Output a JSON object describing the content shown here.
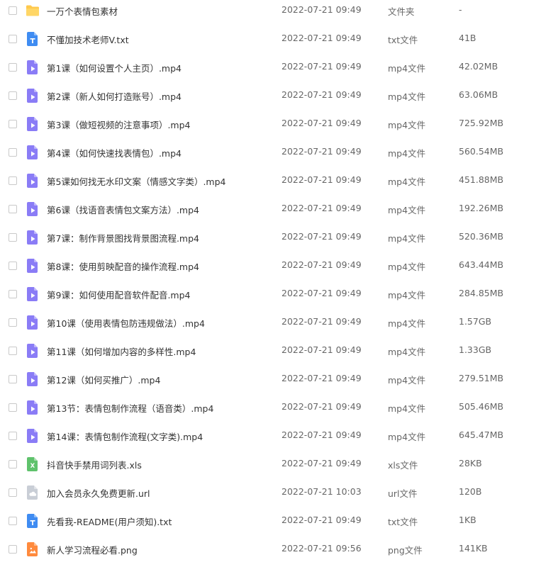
{
  "files": [
    {
      "name": "一万个表情包素材",
      "date": "2022-07-21 09:49",
      "type": "文件夹",
      "size": "-",
      "icon": "folder-icon",
      "color": "#ffc94d"
    },
    {
      "name": "不懂加技术老师V.txt",
      "date": "2022-07-21 09:49",
      "type": "txt文件",
      "size": "41B",
      "icon": "txt-file-icon",
      "color": "#3f8cf2"
    },
    {
      "name": "第1课（如何设置个人主页）.mp4",
      "date": "2022-07-21 09:49",
      "type": "mp4文件",
      "size": "42.02MB",
      "icon": "video-file-icon",
      "color": "#8a7cf6"
    },
    {
      "name": "第2课（新人如何打造账号）.mp4",
      "date": "2022-07-21 09:49",
      "type": "mp4文件",
      "size": "63.06MB",
      "icon": "video-file-icon",
      "color": "#8a7cf6"
    },
    {
      "name": "第3课（做短视频的注意事项）.mp4",
      "date": "2022-07-21 09:49",
      "type": "mp4文件",
      "size": "725.92MB",
      "icon": "video-file-icon",
      "color": "#8a7cf6"
    },
    {
      "name": "第4课（如何快速找表情包）.mp4",
      "date": "2022-07-21 09:49",
      "type": "mp4文件",
      "size": "560.54MB",
      "icon": "video-file-icon",
      "color": "#8a7cf6"
    },
    {
      "name": "第5课如何找无水印文案（情感文字类）.mp4",
      "date": "2022-07-21 09:49",
      "type": "mp4文件",
      "size": "451.88MB",
      "icon": "video-file-icon",
      "color": "#8a7cf6"
    },
    {
      "name": "第6课（找语音表情包文案方法）.mp4",
      "date": "2022-07-21 09:49",
      "type": "mp4文件",
      "size": "192.26MB",
      "icon": "video-file-icon",
      "color": "#8a7cf6"
    },
    {
      "name": "第7课：制作背景图找背景图流程.mp4",
      "date": "2022-07-21 09:49",
      "type": "mp4文件",
      "size": "520.36MB",
      "icon": "video-file-icon",
      "color": "#8a7cf6"
    },
    {
      "name": "第8课：使用剪映配音的操作流程.mp4",
      "date": "2022-07-21 09:49",
      "type": "mp4文件",
      "size": "643.44MB",
      "icon": "video-file-icon",
      "color": "#8a7cf6"
    },
    {
      "name": "第9课：如何使用配音软件配音.mp4",
      "date": "2022-07-21 09:49",
      "type": "mp4文件",
      "size": "284.85MB",
      "icon": "video-file-icon",
      "color": "#8a7cf6"
    },
    {
      "name": "第10课（使用表情包防违规做法）.mp4",
      "date": "2022-07-21 09:49",
      "type": "mp4文件",
      "size": "1.57GB",
      "icon": "video-file-icon",
      "color": "#8a7cf6"
    },
    {
      "name": "第11课（如何增加内容的多样性.mp4",
      "date": "2022-07-21 09:49",
      "type": "mp4文件",
      "size": "1.33GB",
      "icon": "video-file-icon",
      "color": "#8a7cf6"
    },
    {
      "name": "第12课（如何买推广）.mp4",
      "date": "2022-07-21 09:49",
      "type": "mp4文件",
      "size": "279.51MB",
      "icon": "video-file-icon",
      "color": "#8a7cf6"
    },
    {
      "name": "第13节：表情包制作流程（语音类）.mp4",
      "date": "2022-07-21 09:49",
      "type": "mp4文件",
      "size": "505.46MB",
      "icon": "video-file-icon",
      "color": "#8a7cf6"
    },
    {
      "name": "第14课：表情包制作流程(文字类).mp4",
      "date": "2022-07-21 09:49",
      "type": "mp4文件",
      "size": "645.47MB",
      "icon": "video-file-icon",
      "color": "#8a7cf6"
    },
    {
      "name": "抖音快手禁用词列表.xls",
      "date": "2022-07-21 09:49",
      "type": "xls文件",
      "size": "28KB",
      "icon": "excel-file-icon",
      "color": "#5fc26c"
    },
    {
      "name": "加入会员永久免费更新.url",
      "date": "2022-07-21 10:03",
      "type": "url文件",
      "size": "120B",
      "icon": "cloud-file-icon",
      "color": "#c9ced6"
    },
    {
      "name": "先看我-README(用户须知).txt",
      "date": "2022-07-21 09:49",
      "type": "txt文件",
      "size": "1KB",
      "icon": "txt-file-icon",
      "color": "#3f8cf2"
    },
    {
      "name": "新人学习流程必看.png",
      "date": "2022-07-21 09:56",
      "type": "png文件",
      "size": "141KB",
      "icon": "image-file-icon",
      "color": "#ff8a3d"
    }
  ]
}
